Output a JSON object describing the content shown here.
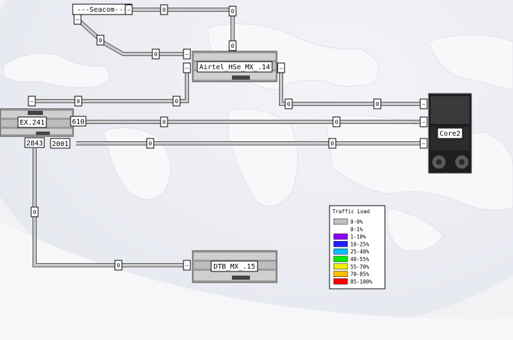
{
  "nodes": {
    "seacom": "---Seacom---",
    "airtel": "Airtel_HSe_MX_.14",
    "ex": "EX.241",
    "core2": "Core2",
    "dtb": "DTB_MX_.15"
  },
  "port_labels": {
    "p610": "610",
    "p2843": "2843",
    "p2001": "2001"
  },
  "link_values": {
    "seacom_top_mid": "0",
    "seacom_right_end": "0",
    "seacom_to_airtel_end": "0",
    "seacom_diag": "0",
    "seacom_lower_mid": "0",
    "ex_airtel_mid": "0",
    "ex_airtel_right": "0",
    "airtel_core_left": "0",
    "airtel_core_right": "0",
    "ex_core_610_left": "0",
    "ex_core_610_right": "0",
    "ex_core_2001_left": "0",
    "ex_core_2001_right": "0",
    "ex_dtb_vert": "0",
    "ex_dtb_horiz": "0"
  },
  "endpoint_mark": "–",
  "legend": {
    "title": "Traffic Load",
    "items": [
      {
        "label": "0-0%",
        "color": "#c0c0c0"
      },
      {
        "label": "0-1%",
        "color": "#ffffff"
      },
      {
        "label": "1-10%",
        "color": "#8c00ff"
      },
      {
        "label": "10-25%",
        "color": "#2020ff"
      },
      {
        "label": "25-40%",
        "color": "#00c0ff"
      },
      {
        "label": "40-55%",
        "color": "#00f000"
      },
      {
        "label": "55-70%",
        "color": "#f0f000"
      },
      {
        "label": "70-85%",
        "color": "#ffc000"
      },
      {
        "label": "85-100%",
        "color": "#ff0000"
      }
    ]
  }
}
